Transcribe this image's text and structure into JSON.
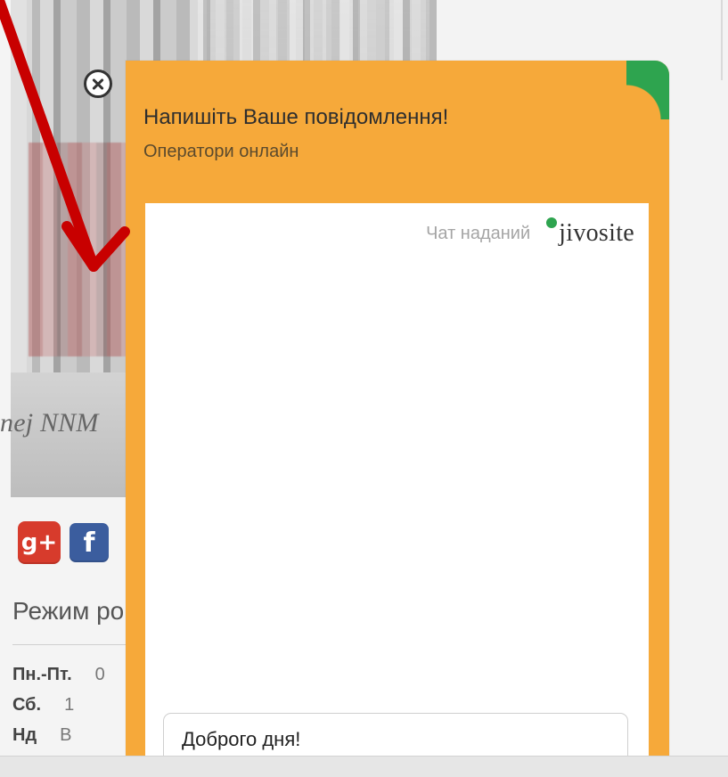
{
  "background": {
    "hero_caption": "nej NNM",
    "social": {
      "google_plus": "g+",
      "facebook": "f"
    },
    "hours": {
      "title": "Режим ро",
      "rows": [
        {
          "day": "Пн.-Пт.",
          "value": "0"
        },
        {
          "day": "Сб.",
          "value": "1"
        },
        {
          "day": "Нд",
          "value": "В"
        }
      ]
    }
  },
  "chat": {
    "title": "Напишіть Ваше повідомлення!",
    "subtitle": "Оператори онлайн",
    "provided_by": "Чат наданий",
    "brand": "jivosite",
    "input": {
      "value": "Доброго дня!"
    },
    "colors": {
      "panel": "#f6a93a",
      "online": "#2ea44f",
      "arrow": "#c80000"
    }
  }
}
